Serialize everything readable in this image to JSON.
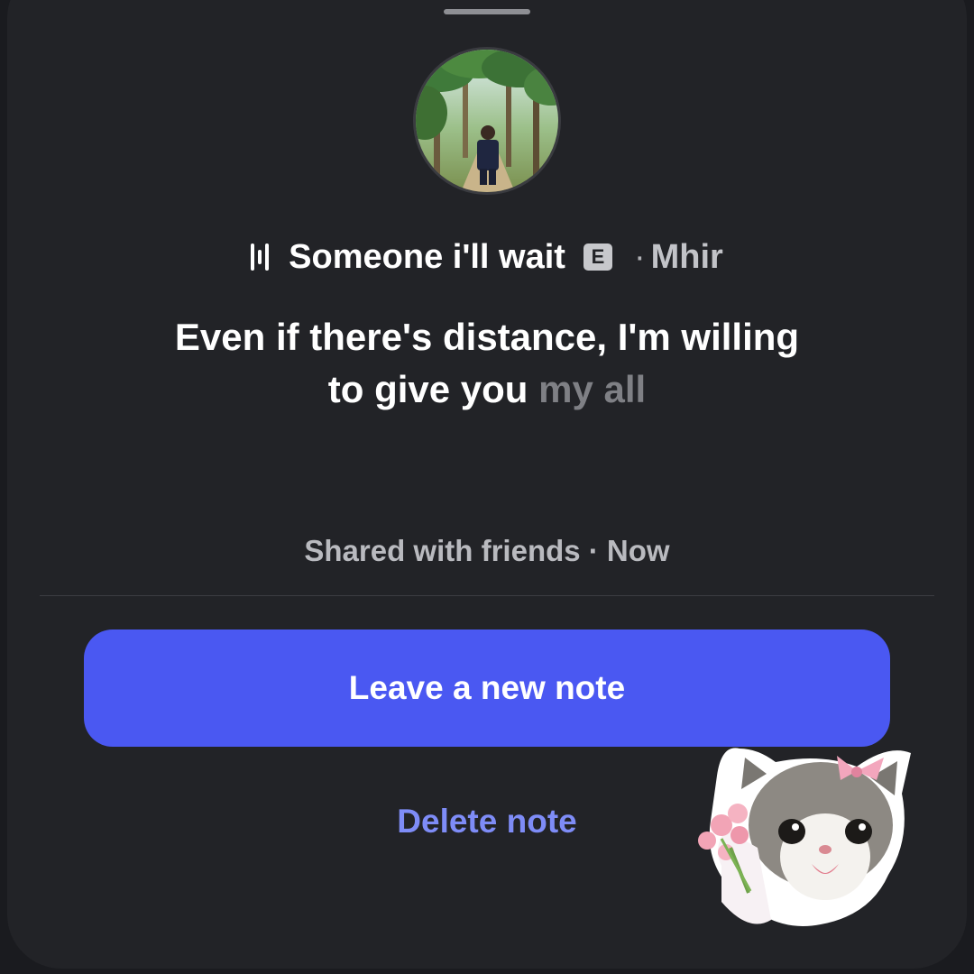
{
  "note": {
    "song_title": "Someone i'll wait",
    "explicit_badge": "E",
    "artist_separator": "·",
    "artist": "Mhir",
    "lyric_line1": "Even if there's distance, I'm willing",
    "lyric_line2_active": "to give you",
    "lyric_line2_dim": "my all",
    "shared_text": "Shared with friends · Now"
  },
  "actions": {
    "primary_label": "Leave a new note",
    "secondary_label": "Delete note"
  },
  "icons": {
    "music": "audio-bars-icon",
    "explicit": "explicit-icon"
  },
  "colors": {
    "background": "#222327",
    "primary_button": "#4a58f2",
    "link": "#7e8cf7"
  }
}
